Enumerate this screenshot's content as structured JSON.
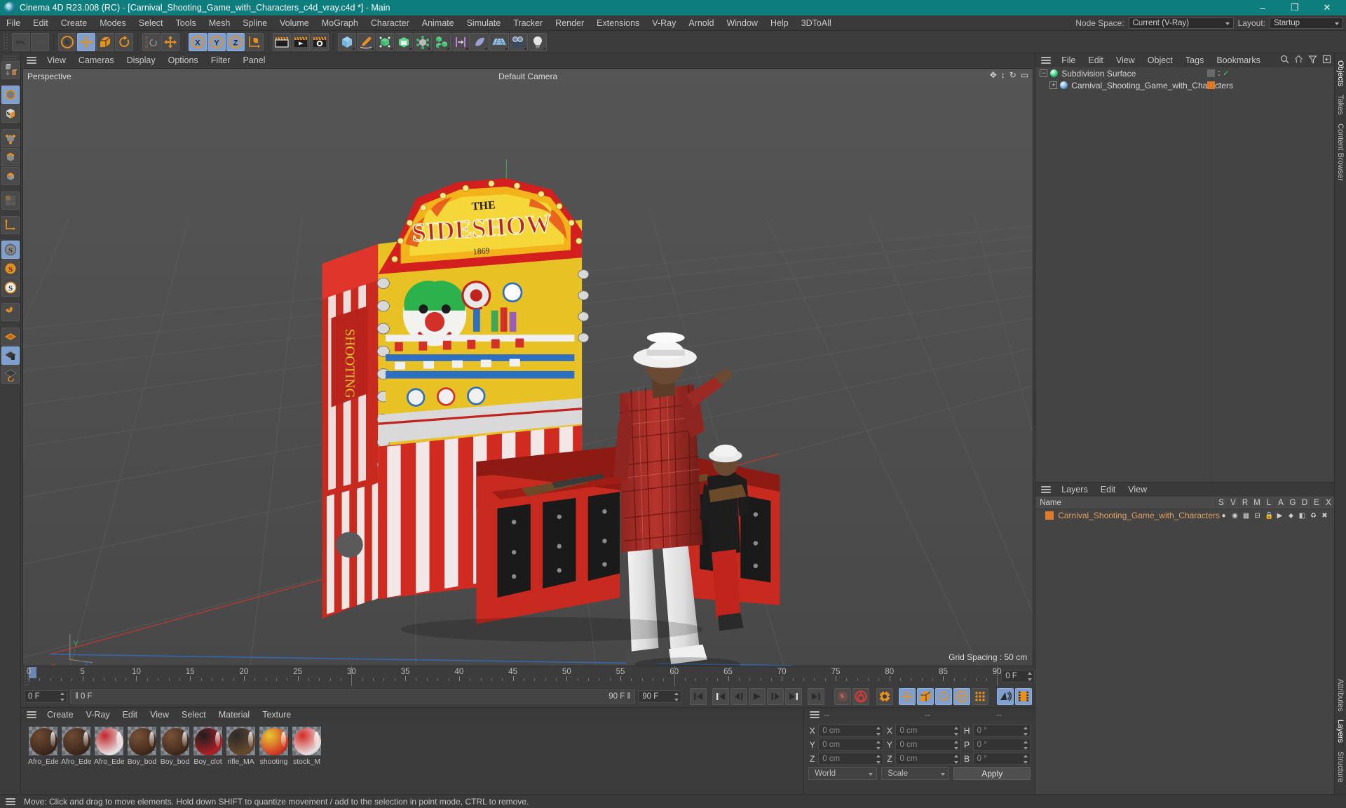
{
  "titlebar": {
    "title": "Cinema 4D R23.008 (RC) - [Carnival_Shooting_Game_with_Characters_c4d_vray.c4d *] - Main",
    "minimize": "–",
    "maximize": "❐",
    "close": "✕"
  },
  "menubar": {
    "items": [
      "File",
      "Edit",
      "Create",
      "Modes",
      "Select",
      "Tools",
      "Mesh",
      "Spline",
      "Volume",
      "MoGraph",
      "Character",
      "Animate",
      "Simulate",
      "Tracker",
      "Render",
      "Extensions",
      "V-Ray",
      "Arnold",
      "Window",
      "Help",
      "3DToAll"
    ],
    "node_space_label": "Node Space:",
    "node_space_value": "Current (V-Ray)",
    "layout_label": "Layout:",
    "layout_value": "Startup"
  },
  "viewport": {
    "menu": [
      "View",
      "Cameras",
      "Display",
      "Options",
      "Filter",
      "Panel"
    ],
    "projection_label": "Perspective",
    "camera_label": "Default Camera",
    "grid_spacing": "Grid Spacing : 50 cm",
    "axis_x": "X",
    "axis_y": "Y",
    "axis_z": "Z"
  },
  "timeline": {
    "ticks": [
      0,
      5,
      10,
      15,
      20,
      25,
      30,
      35,
      40,
      45,
      50,
      55,
      60,
      65,
      70,
      75,
      80,
      85,
      90
    ],
    "current_frame": "0 F",
    "range_start": "0 F",
    "range_end": "90 F",
    "doc_end": "90 F",
    "preview_end": "90 F",
    "right_frame": "0 F"
  },
  "transport": {
    "buttons": [
      {
        "name": "go-to-start-button",
        "glyph": "first"
      },
      {
        "name": "previous-keyframe-button",
        "glyph": "prevkey"
      },
      {
        "name": "step-back-button",
        "glyph": "stepback"
      },
      {
        "name": "play-button",
        "glyph": "play"
      },
      {
        "name": "step-forward-button",
        "glyph": "stepfwd"
      },
      {
        "name": "next-keyframe-button",
        "glyph": "nextkey"
      },
      {
        "name": "go-to-end-button",
        "glyph": "last"
      }
    ]
  },
  "materials": {
    "menu": [
      "Create",
      "V-Ray",
      "Edit",
      "View",
      "Select",
      "Material",
      "Texture"
    ],
    "items": [
      {
        "label": "Afro_Ede",
        "c1": "#6e4a33",
        "c2": "#3a251a"
      },
      {
        "label": "Afro_Ede",
        "c1": "#6e4a33",
        "c2": "#3a251a"
      },
      {
        "label": "Afro_Ede",
        "c1": "#c0272d",
        "c2": "#e8e8e8"
      },
      {
        "label": "Boy_bod",
        "c1": "#7a5238",
        "c2": "#3d2719"
      },
      {
        "label": "Boy_bod",
        "c1": "#7a5238",
        "c2": "#3d2719"
      },
      {
        "label": "Boy_clot",
        "c1": "#1e1e1e",
        "c2": "#b02026"
      },
      {
        "label": "rifle_MA",
        "c1": "#2a2a2a",
        "c2": "#6b4a2e"
      },
      {
        "label": "shooting",
        "c1": "#e8c832",
        "c2": "#d03224"
      },
      {
        "label": "stock_M",
        "c1": "#d42a25",
        "c2": "#e6e6e6"
      }
    ]
  },
  "coordinates": {
    "header_dashes": [
      "--",
      "--",
      "--"
    ],
    "rows": [
      {
        "l1": "X",
        "v1": "0 cm",
        "l2": "X",
        "v2": "0 cm",
        "l3": "H",
        "v3": "0 °"
      },
      {
        "l1": "Y",
        "v1": "0 cm",
        "l2": "Y",
        "v2": "0 cm",
        "l3": "P",
        "v3": "0 °"
      },
      {
        "l1": "Z",
        "v1": "0 cm",
        "l2": "Z",
        "v2": "0 cm",
        "l3": "B",
        "v3": "0 °"
      }
    ],
    "system": "World",
    "mode": "Scale",
    "apply": "Apply"
  },
  "object_manager": {
    "menu": [
      "File",
      "Edit",
      "View",
      "Object",
      "Tags",
      "Bookmarks"
    ],
    "rows": [
      {
        "label": "Subdivision Surface",
        "depth": 0,
        "icon_color": "#2fd37a",
        "expander": "−",
        "tag_color": "#6b6b6b",
        "check": "✓"
      },
      {
        "label": "Carnival_Shooting_Game_with_Characters",
        "depth": 1,
        "icon_color": "#6aa7e8",
        "expander": "+",
        "tag_color": "#e07a28",
        "check": ""
      }
    ]
  },
  "layers_manager": {
    "menu": [
      "Layers",
      "Edit",
      "View"
    ],
    "columns": [
      "Name",
      "S",
      "V",
      "R",
      "M",
      "L",
      "A",
      "G",
      "D",
      "E",
      "X"
    ],
    "rows": [
      {
        "label": "Carnival_Shooting_Game_with_Characters",
        "color": "#e07a28"
      }
    ]
  },
  "right_tabs": [
    "Objects",
    "Takes",
    "Content Browser"
  ],
  "right_tabs_lower": [
    "Attributes",
    "Layers",
    "Structure"
  ],
  "statusbar": {
    "message": "Move: Click and drag to move elements. Hold down SHIFT to quantize movement / add to the selection in point mode, CTRL to remove."
  },
  "colors": {
    "title_bar": "#0d7d7d",
    "accent_orange": "#e8901e",
    "active_blue": "#7f9fce",
    "panel_bg": "#3c3c3c",
    "viewport_bg": "#4c4c4c",
    "layer_orange": "#e07a28"
  },
  "scene": {
    "banner_main": "SIDESHOW",
    "banner_top": "THE",
    "banner_year": "1869"
  }
}
